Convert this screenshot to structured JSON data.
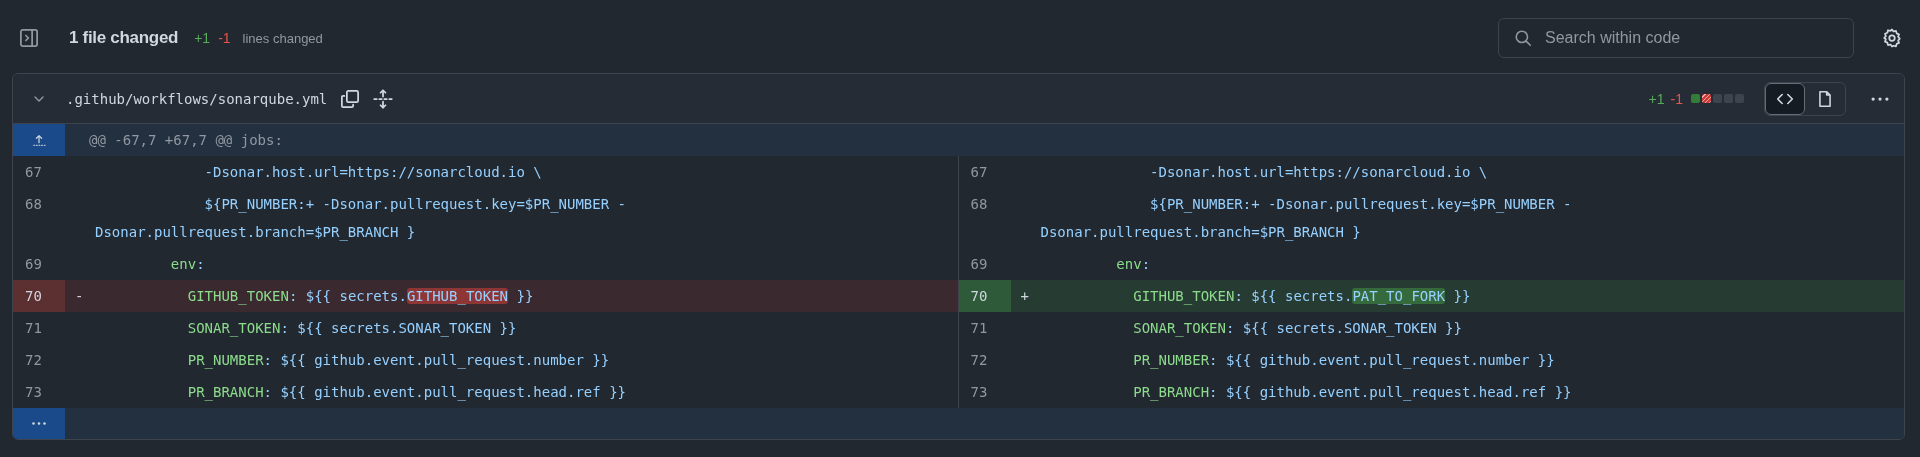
{
  "toolbar": {
    "files_changed": "1 file changed",
    "additions": "+1",
    "deletions": "-1",
    "summary": "lines changed",
    "search": {
      "placeholder": "Search within code"
    }
  },
  "file": {
    "expanded": true,
    "path": ".github/workflows/sonarqube.yml",
    "additions": "+1",
    "deletions": "-1",
    "diffstat": [
      {
        "kind": "added"
      },
      {
        "kind": "deleted"
      },
      {
        "kind": "neutral"
      },
      {
        "kind": "neutral"
      },
      {
        "kind": "neutral"
      }
    ],
    "views": [
      {
        "kind": "code",
        "selected": true
      },
      {
        "kind": "file",
        "selected": false
      }
    ],
    "hunk": "@@ -67,7 +67,7 @@ jobs:",
    "rows": [
      {
        "left": {
          "number": "67",
          "kind": "context",
          "segments": [
            {
              "kind": "plain",
              "text": "             -Dsonar.host.url=https://sonarcloud.io \\"
            }
          ]
        },
        "right": {
          "number": "67",
          "kind": "context",
          "segments": [
            {
              "kind": "plain",
              "text": "             -Dsonar.host.url=https://sonarcloud.io \\"
            }
          ]
        }
      },
      {
        "left": {
          "number": "68",
          "kind": "context",
          "segments": [
            {
              "kind": "plain",
              "text": "             ${PR_NUMBER:+ -Dsonar.pullrequest.key=$PR_NUMBER -"
            }
          ],
          "continuation": "Dsonar.pullrequest.branch=$PR_BRANCH }"
        },
        "right": {
          "number": "68",
          "kind": "context",
          "segments": [
            {
              "kind": "plain",
              "text": "             ${PR_NUMBER:+ -Dsonar.pullrequest.key=$PR_NUMBER -"
            }
          ],
          "continuation": "Dsonar.pullrequest.branch=$PR_BRANCH }"
        }
      },
      {
        "left": {
          "number": "69",
          "kind": "context",
          "segments": [
            {
              "kind": "key",
              "text": "         env"
            },
            {
              "kind": "plain",
              "text": ":"
            }
          ]
        },
        "right": {
          "number": "69",
          "kind": "context",
          "segments": [
            {
              "kind": "key",
              "text": "         env"
            },
            {
              "kind": "plain",
              "text": ":"
            }
          ]
        }
      },
      {
        "left": {
          "number": "70",
          "kind": "deleted",
          "sign": "-",
          "segments": [
            {
              "kind": "key",
              "text": "           GITHUB_TOKEN"
            },
            {
              "kind": "plain",
              "text": ": ${{ secrets."
            },
            {
              "kind": "changed",
              "text": "GITHUB_TOKEN"
            },
            {
              "kind": "plain",
              "text": " }}"
            }
          ]
        },
        "right": {
          "number": "70",
          "kind": "added",
          "sign": "+",
          "segments": [
            {
              "kind": "key",
              "text": "           GITHUB_TOKEN"
            },
            {
              "kind": "plain",
              "text": ": ${{ secrets."
            },
            {
              "kind": "changed",
              "text": "PAT_TO_FORK"
            },
            {
              "kind": "plain",
              "text": " }}"
            }
          ]
        }
      },
      {
        "left": {
          "number": "71",
          "kind": "context",
          "segments": [
            {
              "kind": "key",
              "text": "           SONAR_TOKEN"
            },
            {
              "kind": "plain",
              "text": ": ${{ secrets.SONAR_TOKEN }}"
            }
          ]
        },
        "right": {
          "number": "71",
          "kind": "context",
          "segments": [
            {
              "kind": "key",
              "text": "           SONAR_TOKEN"
            },
            {
              "kind": "plain",
              "text": ": ${{ secrets.SONAR_TOKEN }}"
            }
          ]
        }
      },
      {
        "left": {
          "number": "72",
          "kind": "context",
          "segments": [
            {
              "kind": "key",
              "text": "           PR_NUMBER"
            },
            {
              "kind": "plain",
              "text": ": ${{ github.event.pull_request.number }}"
            }
          ]
        },
        "right": {
          "number": "72",
          "kind": "context",
          "segments": [
            {
              "kind": "key",
              "text": "           PR_NUMBER"
            },
            {
              "kind": "plain",
              "text": ": ${{ github.event.pull_request.number }}"
            }
          ]
        }
      },
      {
        "left": {
          "number": "73",
          "kind": "context",
          "segments": [
            {
              "kind": "key",
              "text": "           PR_BRANCH"
            },
            {
              "kind": "plain",
              "text": ": ${{ github.event.pull_request.head.ref }}"
            }
          ]
        },
        "right": {
          "number": "73",
          "kind": "context",
          "segments": [
            {
              "kind": "key",
              "text": "           PR_BRANCH"
            },
            {
              "kind": "plain",
              "text": ": ${{ github.event.pull_request.head.ref }}"
            }
          ]
        }
      }
    ]
  }
}
